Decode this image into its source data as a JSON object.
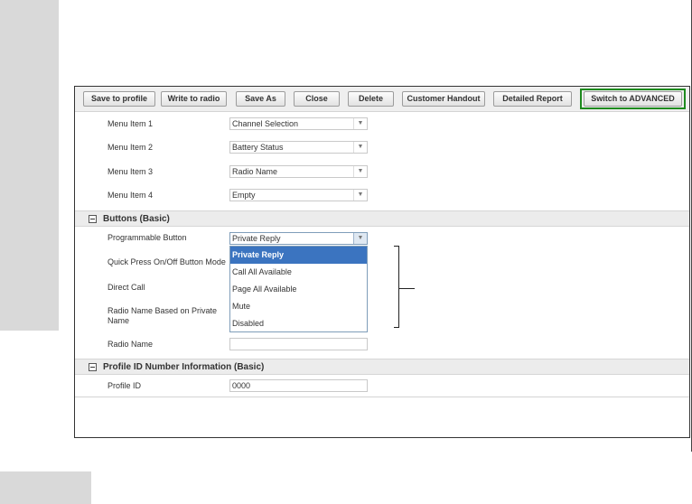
{
  "toolbar": {
    "save_to_profile": "Save to profile",
    "write_to_radio": "Write to radio",
    "save_as": "Save As",
    "close": "Close",
    "delete": "Delete",
    "customer_handout": "Customer Handout",
    "detailed_report": "Detailed Report",
    "switch_advanced": "Switch to ADVANCED"
  },
  "menu_items": [
    {
      "label": "Menu Item 1",
      "value": "Channel Selection"
    },
    {
      "label": "Menu Item 2",
      "value": "Battery Status"
    },
    {
      "label": "Menu Item 3",
      "value": "Radio Name"
    },
    {
      "label": "Menu Item 4",
      "value": "Empty"
    }
  ],
  "buttons_section": {
    "title": "Buttons (Basic)",
    "programmable_button": {
      "label": "Programmable Button",
      "value": "Private Reply"
    },
    "quick_press_label": "Quick Press On/Off Button Mode",
    "direct_call_label": "Direct Call",
    "radio_name_based_label": "Radio Name Based on Private Name",
    "radio_name": {
      "label": "Radio Name",
      "value": ""
    }
  },
  "dropdown_options": [
    "Private Reply",
    "Call All Available",
    "Page All Available",
    "Mute",
    "Disabled"
  ],
  "profile_section": {
    "title": "Profile ID Number Information (Basic)",
    "profile_id": {
      "label": "Profile ID",
      "value": "0000"
    }
  },
  "colors": {
    "highlight": "#3b74c0",
    "advanced_border": "#1e8a1e"
  }
}
